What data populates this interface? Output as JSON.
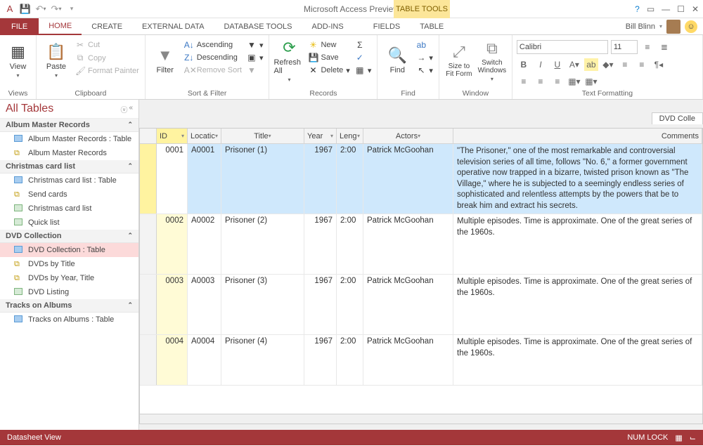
{
  "app": {
    "title": "Microsoft Access Preview",
    "context_title": "TABLE TOOLS"
  },
  "user": {
    "name": "Bill Blinn"
  },
  "tabs": {
    "file": "FILE",
    "home": "HOME",
    "create": "CREATE",
    "external": "EXTERNAL DATA",
    "dbtools": "DATABASE TOOLS",
    "addins": "ADD-INS",
    "fields": "FIELDS",
    "table": "TABLE"
  },
  "ribbon": {
    "views_btn": "View",
    "views_grp": "Views",
    "paste": "Paste",
    "cut": "Cut",
    "copy": "Copy",
    "fmtpainter": "Format Painter",
    "clipboard_grp": "Clipboard",
    "filter": "Filter",
    "asc": "Ascending",
    "desc": "Descending",
    "remove_sort": "Remove Sort",
    "sort_grp": "Sort & Filter",
    "refresh": "Refresh All",
    "new": "New",
    "save": "Save",
    "delete": "Delete",
    "records_grp": "Records",
    "find": "Find",
    "find_grp": "Find",
    "size": "Size to Fit Form",
    "switch": "Switch Windows",
    "window_grp": "Window",
    "font_name": "Calibri",
    "font_size": "11",
    "fmt_grp": "Text Formatting"
  },
  "nav": {
    "title": "All Tables",
    "groups": [
      {
        "header": "Album Master Records",
        "items": [
          {
            "icon": "table",
            "label": "Album Master Records : Table"
          },
          {
            "icon": "query",
            "label": "Album Master Records"
          }
        ]
      },
      {
        "header": "Christmas card list",
        "items": [
          {
            "icon": "table",
            "label": "Christmas card list : Table"
          },
          {
            "icon": "query",
            "label": "Send cards"
          },
          {
            "icon": "report",
            "label": "Christmas card list"
          },
          {
            "icon": "report",
            "label": "Quick list"
          }
        ]
      },
      {
        "header": "DVD Collection",
        "items": [
          {
            "icon": "table",
            "label": "DVD Collection : Table",
            "selected": true
          },
          {
            "icon": "query",
            "label": "DVDs by Title"
          },
          {
            "icon": "query",
            "label": "DVDs by Year, Title"
          },
          {
            "icon": "report",
            "label": "DVD Listing"
          }
        ]
      },
      {
        "header": "Tracks on Albums",
        "items": [
          {
            "icon": "table",
            "label": "Tracks on Albums : Table"
          }
        ]
      }
    ]
  },
  "doc": {
    "tab": "DVD Colle",
    "columns": [
      "ID",
      "Locatic",
      "Title",
      "Year",
      "Leng",
      "Actors",
      "Comments"
    ],
    "rows": [
      {
        "id": "0001",
        "loc": "A0001",
        "title": "Prisoner (1)",
        "year": "1967",
        "len": "2:00",
        "actors": "Patrick McGoohan",
        "comments": "\"The Prisoner,\" one of the most remarkable and controversial television series of all time, follows \"No. 6,\" a former government operative now trapped in a bizarre, twisted prison known as \"The Village,\" where he is subjected to a seemingly endless series of sophisticated and relentless attempts by the powers that be to break him and extract his secrets.",
        "selected": true
      },
      {
        "id": "0002",
        "loc": "A0002",
        "title": "Prisoner (2)",
        "year": "1967",
        "len": "2:00",
        "actors": "Patrick McGoohan",
        "comments": "Multiple episodes. Time is approximate. One of the great series of the 1960s."
      },
      {
        "id": "0003",
        "loc": "A0003",
        "title": "Prisoner (3)",
        "year": "1967",
        "len": "2:00",
        "actors": "Patrick McGoohan",
        "comments": "Multiple episodes. Time is approximate. One of the great series of the 1960s."
      },
      {
        "id": "0004",
        "loc": "A0004",
        "title": "Prisoner (4)",
        "year": "1967",
        "len": "2:00",
        "actors": "Patrick McGoohan",
        "comments": "Multiple episodes. Time is approximate. One of the great series of the 1960s."
      }
    ]
  },
  "status": {
    "left": "Datasheet View",
    "numlock": "NUM LOCK"
  }
}
